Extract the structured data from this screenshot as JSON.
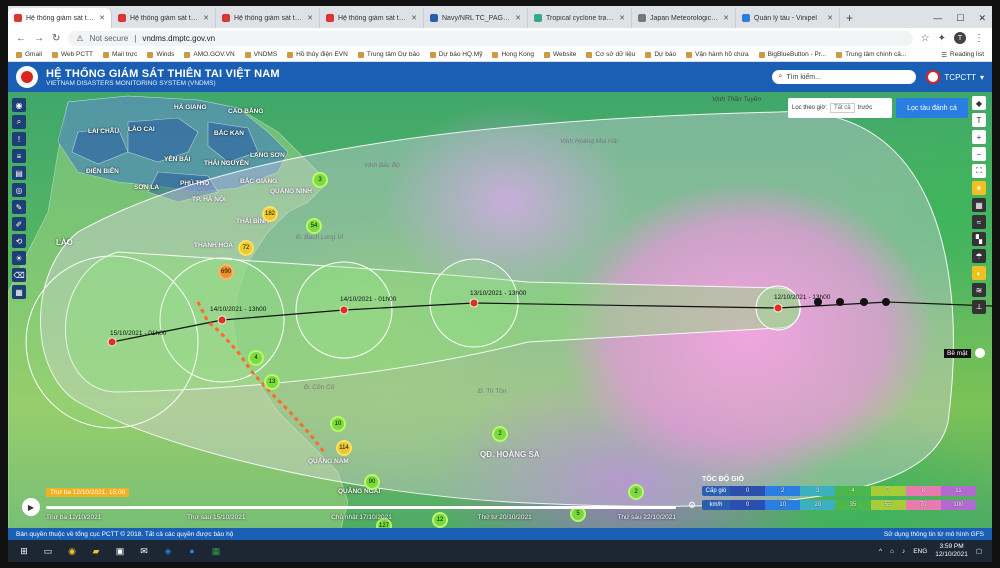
{
  "browser": {
    "tabs": [
      {
        "label": "Hệ thống giám sát thiên tai"
      },
      {
        "label": "Hệ thống giám sát thiên tai"
      },
      {
        "label": "Hệ thống giám sát thiên tai"
      },
      {
        "label": "Hệ thống giám sát thiên tai"
      },
      {
        "label": "Navy/NRL TC_PAGES Page"
      },
      {
        "label": "Tropical cyclone track info"
      },
      {
        "label": "Japan Meteorological Agency"
      },
      {
        "label": "Quản lý tàu - Vinipel"
      }
    ],
    "address_secure": "Not secure",
    "address_host": "vndms.dmptc.gov.vn",
    "profile_initial": "T",
    "bookmarks": [
      "Gmail",
      "Web PCTT",
      "Mail trực",
      "Winds",
      "AMO.GOV.VN",
      "VNDMS",
      "Hồ thủy điện EVN",
      "Trung tâm Dự báo",
      "Dự báo HQ.Mỹ",
      "Hong Kong",
      "Website",
      "Cơ sở dữ liệu",
      "Dự báo",
      "Vận hành hồ chứa",
      "BigBlueButton - Pr...",
      "Trung tâm chính cả..."
    ],
    "reading_list": "Reading list"
  },
  "app": {
    "title": "HỆ THỐNG GIÁM SÁT THIÊN TAI VIỆT NAM",
    "subtitle": "VIETNAM DISASTERS MONITORING SYSTEM (VNDMS)",
    "search_placeholder": "Tìm kiếm...",
    "user": "TCPCTT"
  },
  "map": {
    "filter_label": "Lọc theo giờ:",
    "filter_value": "Tất cả",
    "filter_suffix": "trước",
    "filter_button": "Lọc tàu đánh cá",
    "surface_label": "Bề mặt",
    "places": [
      {
        "name": "HÀ GIANG",
        "cls": "",
        "pos": "a"
      },
      {
        "name": "CAO BẰNG",
        "cls": "",
        "pos": "b"
      },
      {
        "name": "LÀO CAI",
        "cls": "",
        "pos": "c"
      },
      {
        "name": "BẮC KẠN",
        "cls": "",
        "pos": "d"
      },
      {
        "name": "LAI CHÂU",
        "cls": "",
        "pos": "e"
      },
      {
        "name": "YÊN BÁI",
        "cls": "",
        "pos": "f"
      },
      {
        "name": "THÁI NGUYÊN",
        "cls": "",
        "pos": "g"
      },
      {
        "name": "LẠNG SƠN",
        "cls": "",
        "pos": "h"
      },
      {
        "name": "ĐIỆN BIÊN",
        "cls": "",
        "pos": "i"
      },
      {
        "name": "PHÚ THỌ",
        "cls": "",
        "pos": "j"
      },
      {
        "name": "BẮC GIANG",
        "cls": "",
        "pos": "k"
      },
      {
        "name": "SƠN LA",
        "cls": "",
        "pos": "l"
      },
      {
        "name": "QUẢNG NINH",
        "cls": "",
        "pos": "m"
      },
      {
        "name": "TP. HÀ NỘI",
        "cls": "",
        "pos": "n"
      },
      {
        "name": "THÁI BÌNH",
        "cls": "",
        "pos": "o"
      },
      {
        "name": "THANH HÓA",
        "cls": "",
        "pos": "p"
      },
      {
        "name": "LÀO",
        "cls": "big",
        "pos": "q"
      },
      {
        "name": "QUẢNG NAM",
        "cls": "",
        "pos": "r"
      },
      {
        "name": "QUẢNG NGÃI",
        "cls": "",
        "pos": "s"
      },
      {
        "name": "QĐ. HOÀNG SA",
        "cls": "big",
        "pos": "t"
      },
      {
        "name": "Vịnh Bắc Bộ",
        "cls": "sea",
        "pos": "u"
      },
      {
        "name": "Vịnh Thần Tuyền",
        "cls": "sea",
        "pos": "v"
      },
      {
        "name": "Vịnh Hoàng Mai Hải",
        "cls": "sea",
        "pos": "w"
      },
      {
        "name": "Đ. Bạch Long Vĩ",
        "cls": "sea",
        "pos": "x"
      },
      {
        "name": "Đ. Cồn Cỏ",
        "cls": "sea",
        "pos": "y"
      },
      {
        "name": "Đ. Tri Tôn",
        "cls": "sea",
        "pos": "z"
      }
    ],
    "forecasts": [
      {
        "label": "12/10/2021 - 13h00"
      },
      {
        "label": "13/10/2021 - 13h00"
      },
      {
        "label": "14/10/2021 - 01h00"
      },
      {
        "label": "14/10/2021 - 13h00"
      },
      {
        "label": "15/10/2021 - 01h00"
      }
    ],
    "clusters": [
      "182",
      "690",
      "54",
      "72",
      "4",
      "13",
      "10",
      "114",
      "90",
      "2",
      "2",
      "12",
      "5",
      "3",
      "127"
    ]
  },
  "legend": {
    "title": "TỐC ĐỘ GIÓ",
    "rows": [
      {
        "head": "Cấp gió",
        "values": [
          "0",
          "2",
          "3",
          "4",
          "7",
          "8",
          "11"
        ]
      },
      {
        "head": "km/h",
        "values": [
          "0",
          "10",
          "20",
          "35",
          "55",
          "70",
          "100"
        ]
      }
    ],
    "colors": [
      "#2a4fb0",
      "#2a7de1",
      "#3ab0c0",
      "#4cb84c",
      "#a6cc3a",
      "#e87ab0",
      "#b06ad0"
    ]
  },
  "timeline": {
    "current": "Thứ ba 12/10/2021, 15:00",
    "ticks": [
      "Thứ ba 12/10/2021",
      "Thứ sáu 15/10/2021",
      "Chủ nhật 17/10/2021",
      "Thứ tư 20/10/2021",
      "Thứ sáu 22/10/2021"
    ]
  },
  "footer": {
    "left": "Bản quyền thuộc về tổng cục PCTT © 2018. Tất cả các quyền được bảo hộ",
    "right": "Sử dụng thông tin từ mô hình GFS"
  },
  "taskbar": {
    "lang": "ENG",
    "time": "3:59 PM",
    "date": "12/10/2021"
  }
}
